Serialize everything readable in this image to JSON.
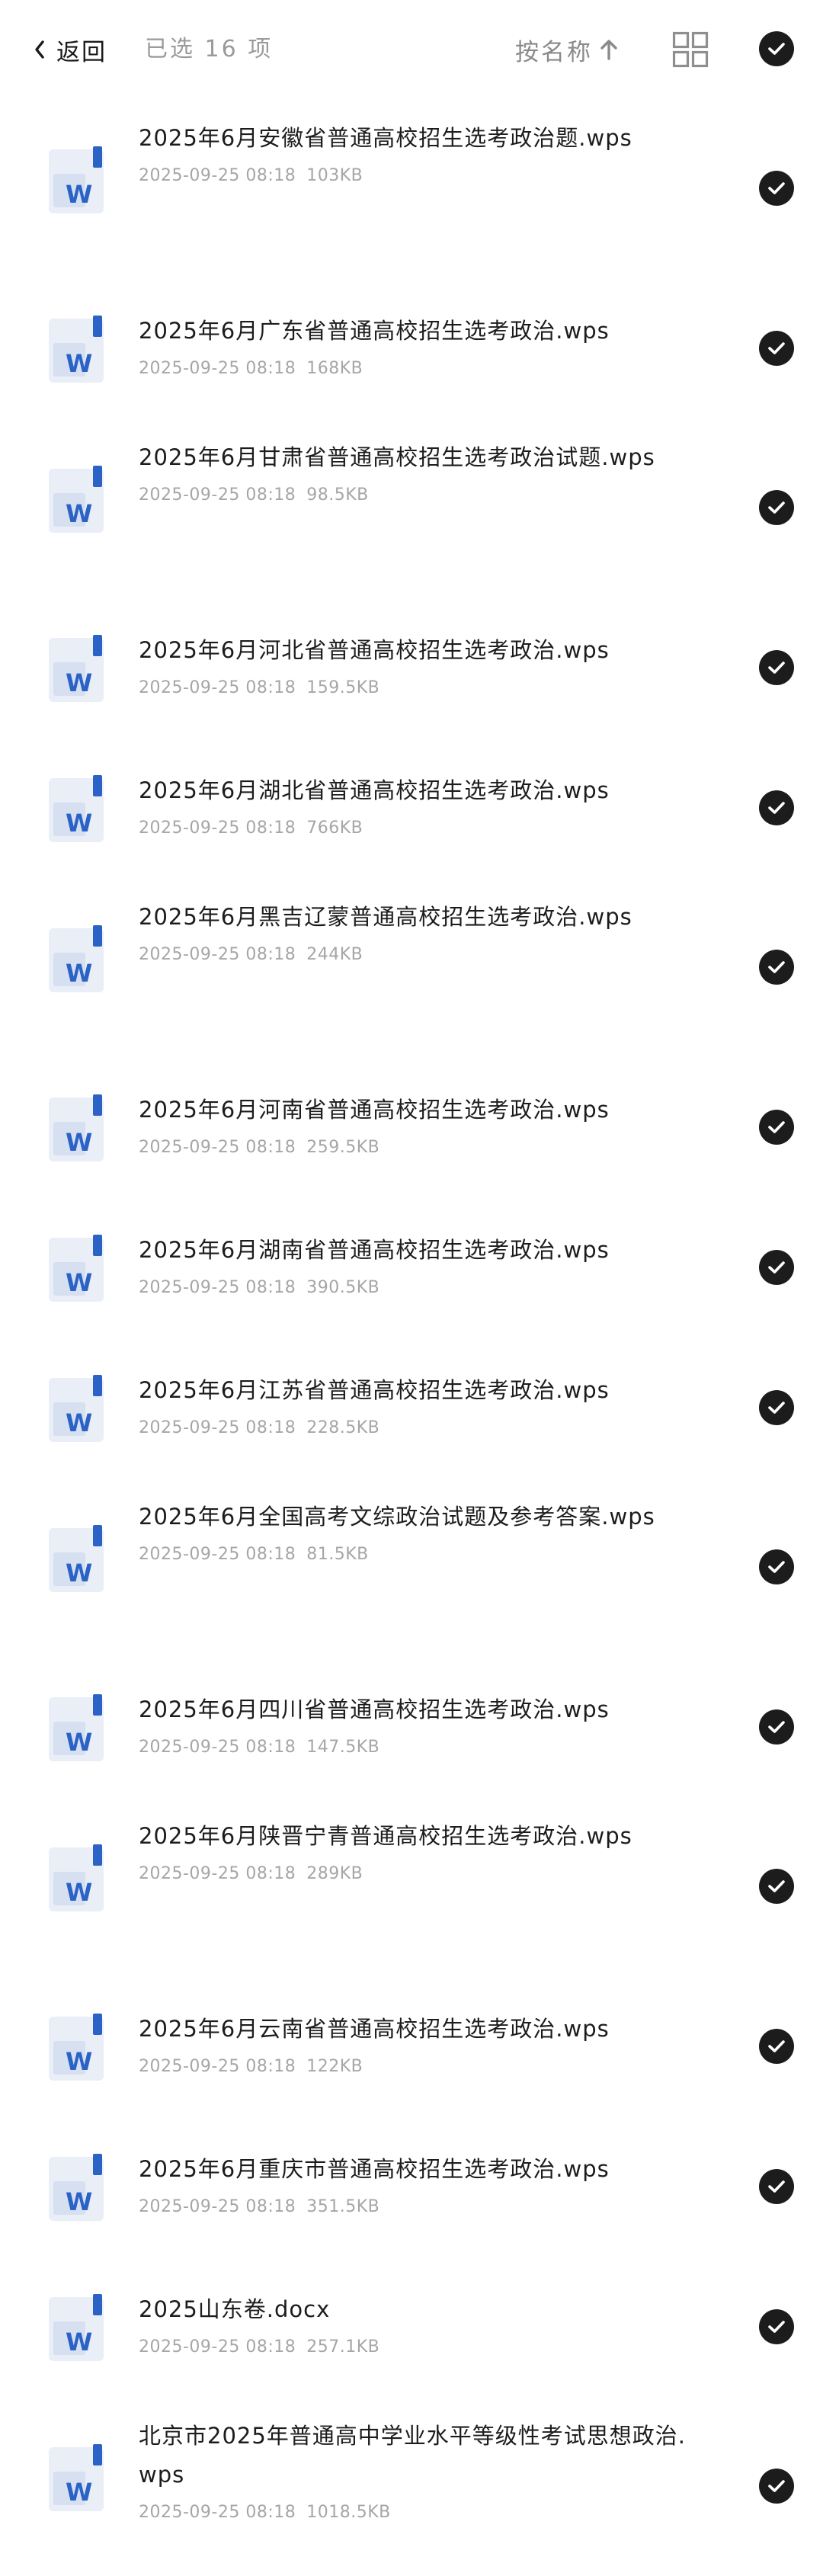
{
  "header": {
    "back_label": "返回",
    "selected_text": "已选 16 项",
    "sort_label": "按名称",
    "icons": {
      "back": "chevron-left-icon",
      "sort": "arrow-up-icon",
      "view": "grid-view-icon",
      "select_all": "check-circle-icon"
    }
  },
  "colors": {
    "check_fill": "#1c1c1c",
    "doc_icon_accent": "#2b62c6",
    "doc_icon_page": "#e9eef7",
    "meta_text": "#a6a6a6",
    "muted_text": "#9a9a9a"
  },
  "files": [
    {
      "name": "2025年6月安徽省普通高校招生选考政治题.wps",
      "date": "2025-09-25 08:18",
      "size": "103KB",
      "selected": true,
      "icon": "word-doc-icon"
    },
    {
      "name": "2025年6月广东省普通高校招生选考政治.wps",
      "date": "2025-09-25 08:18",
      "size": "168KB",
      "selected": true,
      "icon": "word-doc-icon"
    },
    {
      "name": "2025年6月甘肃省普通高校招生选考政治试题.wps",
      "date": "2025-09-25 08:18",
      "size": "98.5KB",
      "selected": true,
      "icon": "word-doc-icon"
    },
    {
      "name": "2025年6月河北省普通高校招生选考政治.wps",
      "date": "2025-09-25 08:18",
      "size": "159.5KB",
      "selected": true,
      "icon": "word-doc-icon"
    },
    {
      "name": "2025年6月湖北省普通高校招生选考政治.wps",
      "date": "2025-09-25 08:18",
      "size": "766KB",
      "selected": true,
      "icon": "word-doc-icon"
    },
    {
      "name": "2025年6月黑吉辽蒙普通高校招生选考政治.wps",
      "date": "2025-09-25 08:18",
      "size": "244KB",
      "selected": true,
      "icon": "word-doc-icon"
    },
    {
      "name": "2025年6月河南省普通高校招生选考政治.wps",
      "date": "2025-09-25 08:18",
      "size": "259.5KB",
      "selected": true,
      "icon": "word-doc-icon"
    },
    {
      "name": "2025年6月湖南省普通高校招生选考政治.wps",
      "date": "2025-09-25 08:18",
      "size": "390.5KB",
      "selected": true,
      "icon": "word-doc-icon"
    },
    {
      "name": "2025年6月江苏省普通高校招生选考政治.wps",
      "date": "2025-09-25 08:18",
      "size": "228.5KB",
      "selected": true,
      "icon": "word-doc-icon"
    },
    {
      "name": "2025年6月全国高考文综政治试题及参考答案.wps",
      "date": "2025-09-25 08:18",
      "size": "81.5KB",
      "selected": true,
      "icon": "word-doc-icon"
    },
    {
      "name": "2025年6月四川省普通高校招生选考政治.wps",
      "date": "2025-09-25 08:18",
      "size": "147.5KB",
      "selected": true,
      "icon": "word-doc-icon"
    },
    {
      "name": "2025年6月陕晋宁青普通高校招生选考政治.wps",
      "date": "2025-09-25 08:18",
      "size": "289KB",
      "selected": true,
      "icon": "word-doc-icon"
    },
    {
      "name": "2025年6月云南省普通高校招生选考政治.wps",
      "date": "2025-09-25 08:18",
      "size": "122KB",
      "selected": true,
      "icon": "word-doc-icon"
    },
    {
      "name": "2025年6月重庆市普通高校招生选考政治.wps",
      "date": "2025-09-25 08:18",
      "size": "351.5KB",
      "selected": true,
      "icon": "word-doc-icon"
    },
    {
      "name": "2025山东卷.docx",
      "date": "2025-09-25 08:18",
      "size": "257.1KB",
      "selected": true,
      "icon": "word-doc-icon"
    },
    {
      "name": "北京市2025年普通高中学业水平等级性考试思想政治.wps",
      "date": "2025-09-25 08:18",
      "size": "1018.5KB",
      "selected": true,
      "icon": "word-doc-icon"
    }
  ]
}
